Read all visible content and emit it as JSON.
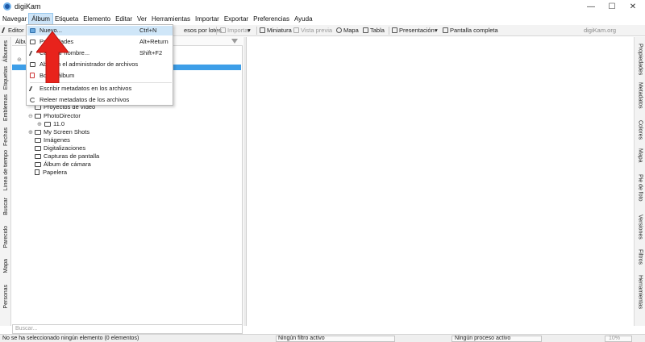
{
  "window": {
    "title": "digiKam",
    "minimize": "—",
    "maximize": "☐",
    "close": "✕"
  },
  "menubar": [
    "Navegar",
    "Álbum",
    "Etiqueta",
    "Elemento",
    "Editar",
    "Ver",
    "Herramientas",
    "Importar",
    "Exportar",
    "Preferencias",
    "Ayuda"
  ],
  "toolbar": {
    "editor": "Editor",
    "batch": "esos por lotes",
    "import": "Importar",
    "thumbnail": "Miniatura",
    "preview": "Vista previa",
    "map": "Mapa",
    "table": "Tabla",
    "slideshow": "Presentación",
    "fullscreen": "Pantalla completa",
    "site_link": "digiKam.org"
  },
  "left_tabs": [
    "Álbumes",
    "Etiquetas",
    "Emblemas",
    "Fechas",
    "Línea de tiempo",
    "Buscar",
    "Parecido",
    "Mapa",
    "Personas"
  ],
  "right_tabs": [
    "Propiedades",
    "Metadatos",
    "Colores",
    "Mapa",
    "Pie de foto",
    "Versiones",
    "Filtros",
    "Herramientas"
  ],
  "album_panel": {
    "header": "Álbu",
    "tree": [
      "Proyectos de vídeo",
      "PhotoDirector",
      "11.0",
      "My Screen Shots",
      "Imágenes",
      "Digitalizaciones",
      "Capturas de pantalla",
      "Álbum de cámara",
      "Papelera"
    ],
    "search_placeholder": "Buscar..."
  },
  "album_menu": {
    "items": [
      {
        "label": "Nuevo...",
        "shortcut": "Ctrl+N"
      },
      {
        "label": "Propiedades",
        "shortcut": "Alt+Return"
      },
      {
        "label": "Cambiar nombre...",
        "shortcut": "Shift+F2"
      },
      {
        "label": "Abrir en el administrador de archivos",
        "shortcut": ""
      },
      {
        "label": "Borrar álbum",
        "shortcut": ""
      },
      {
        "label": "Escribir metadatos en los archivos",
        "shortcut": ""
      },
      {
        "label": "Releer metadatos de los archivos",
        "shortcut": ""
      }
    ]
  },
  "statusbar": {
    "selection": "No se ha seleccionado ningún elemento (0 elementos)",
    "filter": "Ningún filtro activo",
    "process": "Ningún proceso activo",
    "zoom": "10%"
  },
  "colors": {
    "selection": "#3d9ee8",
    "menu_highlight": "#cfe6f8",
    "annotation_arrow": "#e8231c"
  }
}
